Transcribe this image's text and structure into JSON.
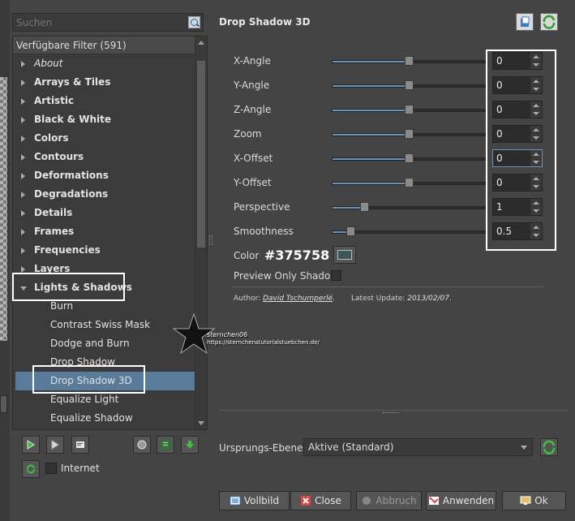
{
  "search": {
    "placeholder": "Suchen"
  },
  "tree": {
    "header": "Verfügbare Filter (591)",
    "categories": [
      {
        "label": "About",
        "italic": true
      },
      {
        "label": "Arrays & Tiles"
      },
      {
        "label": "Artistic"
      },
      {
        "label": "Black & White"
      },
      {
        "label": "Colors"
      },
      {
        "label": "Contours"
      },
      {
        "label": "Deformations"
      },
      {
        "label": "Degradations"
      },
      {
        "label": "Details"
      },
      {
        "label": "Frames"
      },
      {
        "label": "Frequencies"
      },
      {
        "label": "Layers"
      },
      {
        "label": "Lights & Shadows"
      }
    ],
    "subitems": [
      "Burn",
      "Contrast Swiss Mask",
      "Dodge and Burn",
      "Drop Shadow",
      "Drop Shadow 3D",
      "Equalize Light",
      "Equalize Shadow"
    ],
    "selected": "Drop Shadow 3D"
  },
  "internet_label": "Internet",
  "filter_title": "Drop Shadow 3D",
  "params": [
    {
      "label": "X-Angle",
      "value": "0",
      "level": 0.5
    },
    {
      "label": "Y-Angle",
      "value": "0",
      "level": 0.5
    },
    {
      "label": "Z-Angle",
      "value": "0",
      "level": 0.5
    },
    {
      "label": "Zoom",
      "value": "0",
      "level": 0.5
    },
    {
      "label": "X-Offset",
      "value": "0",
      "level": 0.5
    },
    {
      "label": "Y-Offset",
      "value": "0",
      "level": 0.5
    },
    {
      "label": "Perspective",
      "value": "1",
      "level": 0.21
    },
    {
      "label": "Smoothness",
      "value": "0.5",
      "level": 0.12
    }
  ],
  "color": {
    "label": "Color",
    "value": "#375758"
  },
  "preview_only_shadow": "Preview Only Shadow",
  "author": {
    "label": "Author:",
    "name": "David Tschumperlé",
    "update_label": "Latest Update:",
    "update_value": "2013/02/07"
  },
  "ursprung": {
    "label": "Ursprungs-Ebenen",
    "value": "Aktive (Standard)"
  },
  "buttons": {
    "vollbild": "Vollbild",
    "close": "Close",
    "abbruch": "Abbruch",
    "anwenden": "Anwenden",
    "ok": "Ok"
  },
  "watermark": {
    "line1": "sternchen06",
    "line2": "https://sternchenstutorialstuebchen.de/"
  }
}
